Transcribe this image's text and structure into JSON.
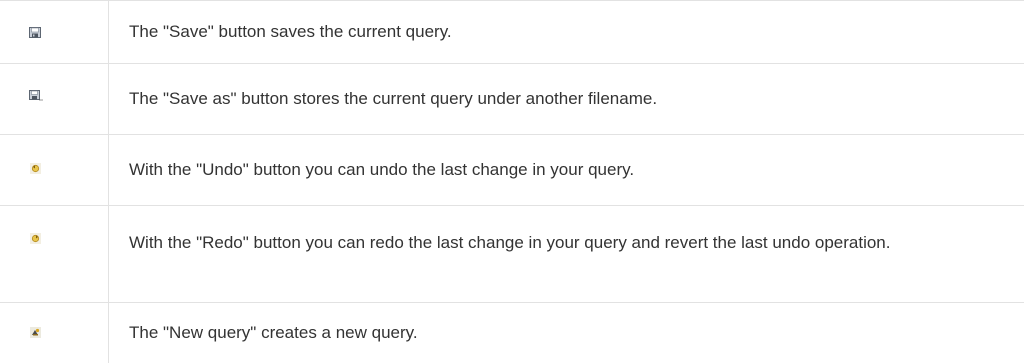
{
  "rows": [
    {
      "icon": "save-icon",
      "text": "The \"Save\" button saves the current query."
    },
    {
      "icon": "save-as-icon",
      "text": "The \"Save as\" button stores the current query under another filename."
    },
    {
      "icon": "undo-icon",
      "text": "With the \"Undo\" button you can undo the last change in your query."
    },
    {
      "icon": "redo-icon",
      "text": "With the \"Redo\" button you can redo the last change in your query and revert the last undo operation."
    },
    {
      "icon": "new-query-icon",
      "text": "The \"New query\" creates a new query."
    }
  ]
}
